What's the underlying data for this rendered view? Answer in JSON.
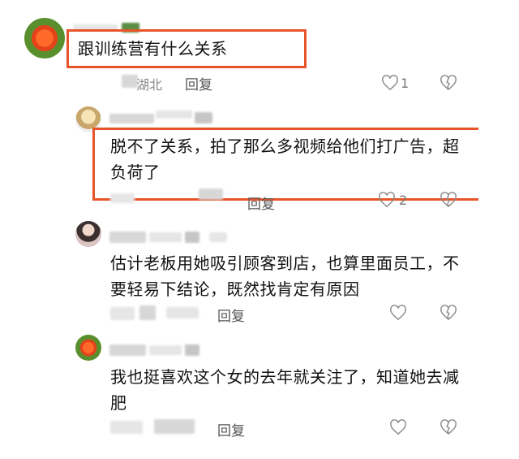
{
  "comments": [
    {
      "text": "跟训练营有什么关系",
      "location": "湖北",
      "reply": "回复",
      "likes": "1"
    },
    {
      "text": "脱不了关系，拍了那么多视频给他们打广告，超负荷了",
      "reply": "回复",
      "likes": "2"
    },
    {
      "text": "估计老板用她吸引顾客到店，也算里面员工，不要轻易下结论，既然找肯定有原因",
      "reply": "回复"
    },
    {
      "text": "我也挺喜欢这个女的去年就关注了，知道她去减肥",
      "reply": "回复"
    }
  ],
  "colors": {
    "highlight": "#e8542a"
  },
  "icons": {
    "like": "heart-outline-icon",
    "dislike": "broken-heart-icon"
  }
}
